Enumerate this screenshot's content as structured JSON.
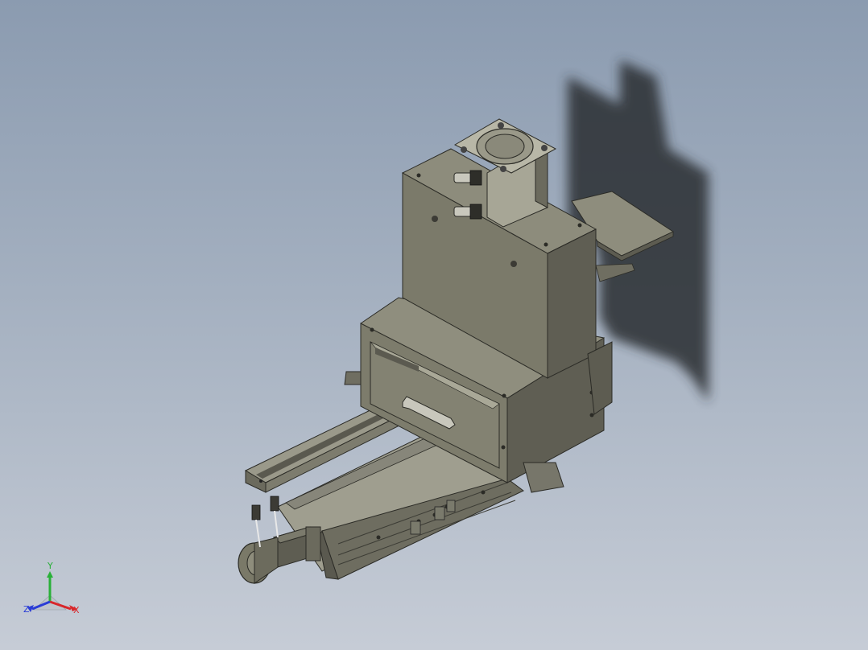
{
  "viewport": {
    "background_top": "#8b9bb0",
    "background_bottom": "#c6ccd6"
  },
  "model": {
    "description_icon": "linear-module-with-cylinder-icon",
    "body_color": "#7c7b6c",
    "dark_face_color": "#5e5d52",
    "shadow_color": "#2a2d31"
  },
  "triad": {
    "x_label": "X",
    "y_label": "Y",
    "z_label": "Z",
    "x_color": "#d8262a",
    "y_color": "#29b038",
    "z_color": "#2a3cd6"
  }
}
